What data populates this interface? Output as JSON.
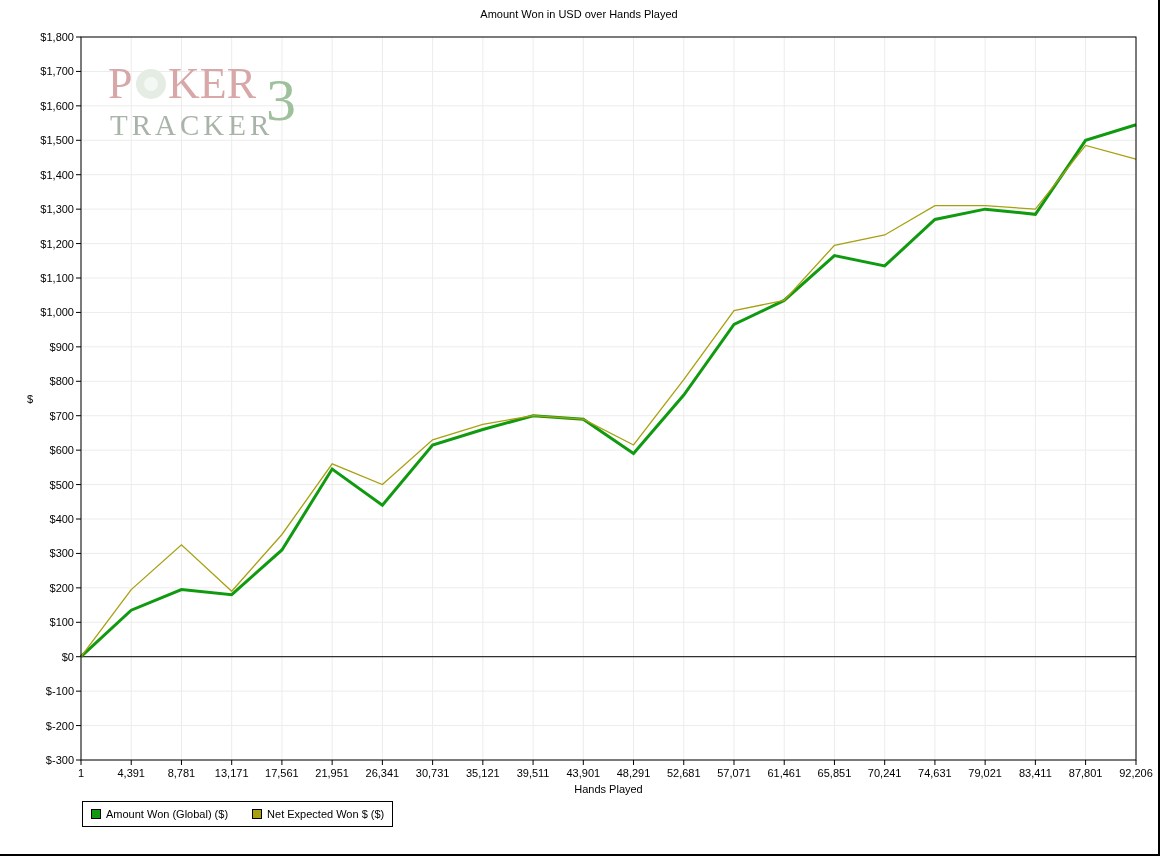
{
  "chart": {
    "title": "Amount Won in USD over Hands Played",
    "chart_data": {
      "type": "line",
      "xlabel": "Hands Played",
      "ylabel": "$",
      "x": [
        1,
        4391,
        8781,
        13171,
        17561,
        21951,
        26341,
        30731,
        35121,
        39511,
        43901,
        48291,
        52681,
        57071,
        61461,
        65851,
        70241,
        74631,
        79021,
        83411,
        87801,
        92206
      ],
      "series": [
        {
          "name": "Amount Won (Global) ($)",
          "color": "#109a10",
          "values": [
            0,
            135,
            195,
            180,
            310,
            545,
            440,
            615,
            660,
            700,
            690,
            590,
            760,
            965,
            1035,
            1165,
            1135,
            1270,
            1300,
            1285,
            1500,
            1545
          ]
        },
        {
          "name": "Net Expected Won $ ($)",
          "color": "#a8a010",
          "values": [
            0,
            195,
            325,
            190,
            355,
            560,
            500,
            630,
            675,
            700,
            690,
            615,
            805,
            1005,
            1035,
            1195,
            1225,
            1310,
            1310,
            1300,
            1485,
            1445
          ]
        }
      ],
      "grid": true,
      "xlim": [
        1,
        92206
      ],
      "ylim": [
        -300,
        1800
      ],
      "xticks": [
        {
          "value": 1,
          "label": "1"
        },
        {
          "value": 4391,
          "label": "4,391"
        },
        {
          "value": 8781,
          "label": "8,781"
        },
        {
          "value": 13171,
          "label": "13,171"
        },
        {
          "value": 17561,
          "label": "17,561"
        },
        {
          "value": 21951,
          "label": "21,951"
        },
        {
          "value": 26341,
          "label": "26,341"
        },
        {
          "value": 30731,
          "label": "30,731"
        },
        {
          "value": 35121,
          "label": "35,121"
        },
        {
          "value": 39511,
          "label": "39,511"
        },
        {
          "value": 43901,
          "label": "43,901"
        },
        {
          "value": 48291,
          "label": "48,291"
        },
        {
          "value": 52681,
          "label": "52,681"
        },
        {
          "value": 57071,
          "label": "57,071"
        },
        {
          "value": 61461,
          "label": "61,461"
        },
        {
          "value": 65851,
          "label": "65,851"
        },
        {
          "value": 70241,
          "label": "70,241"
        },
        {
          "value": 74631,
          "label": "74,631"
        },
        {
          "value": 79021,
          "label": "79,021"
        },
        {
          "value": 83411,
          "label": "83,411"
        },
        {
          "value": 87801,
          "label": "87,801"
        },
        {
          "value": 92206,
          "label": "92,206"
        }
      ],
      "yticks": [
        {
          "value": 1800,
          "label": "$1,800"
        },
        {
          "value": 1700,
          "label": "$1,700"
        },
        {
          "value": 1600,
          "label": "$1,600"
        },
        {
          "value": 1500,
          "label": "$1,500"
        },
        {
          "value": 1400,
          "label": "$1,400"
        },
        {
          "value": 1300,
          "label": "$1,300"
        },
        {
          "value": 1200,
          "label": "$1,200"
        },
        {
          "value": 1100,
          "label": "$1,100"
        },
        {
          "value": 1000,
          "label": "$1,000"
        },
        {
          "value": 900,
          "label": "$900"
        },
        {
          "value": 800,
          "label": "$800"
        },
        {
          "value": 700,
          "label": "$700"
        },
        {
          "value": 600,
          "label": "$600"
        },
        {
          "value": 500,
          "label": "$500"
        },
        {
          "value": 400,
          "label": "$400"
        },
        {
          "value": 300,
          "label": "$300"
        },
        {
          "value": 200,
          "label": "$200"
        },
        {
          "value": 100,
          "label": "$100"
        },
        {
          "value": 0,
          "label": "$0"
        },
        {
          "value": -100,
          "label": "$-100"
        },
        {
          "value": -200,
          "label": "$-200"
        },
        {
          "value": -300,
          "label": "$-300"
        }
      ]
    }
  },
  "logo": {
    "word_start": "P",
    "word_end": "KER",
    "subtitle": "TRACKER",
    "numeral": "3"
  }
}
